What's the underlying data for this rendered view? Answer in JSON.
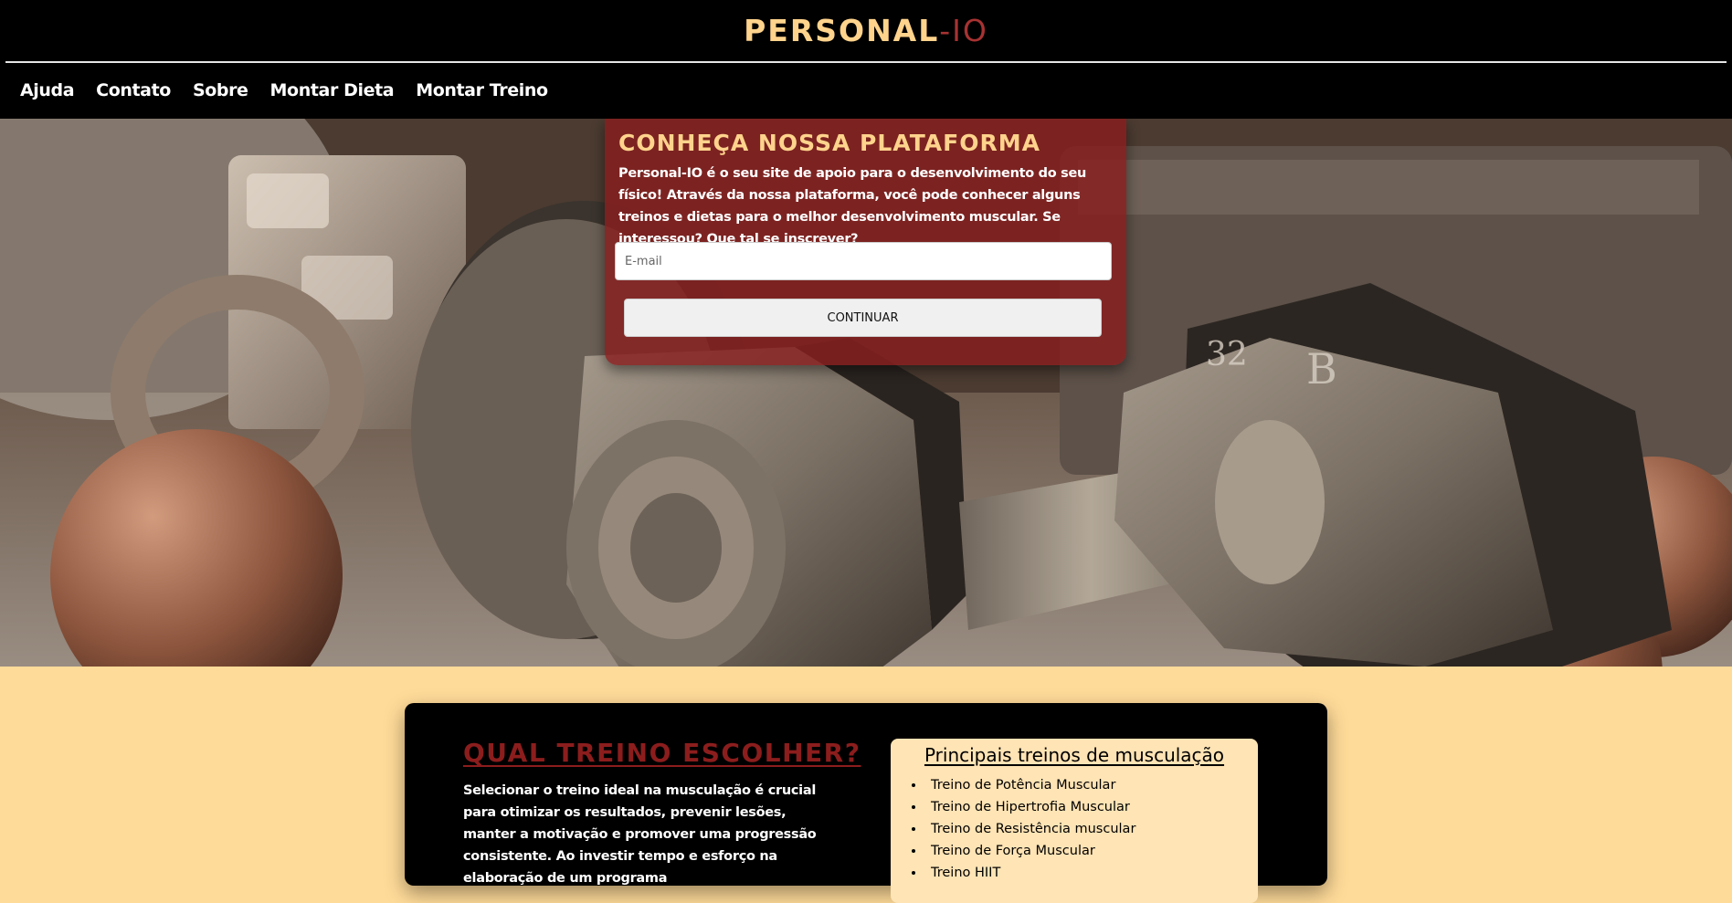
{
  "header": {
    "logo_primary": "PERSONAL",
    "logo_accent": "-IO",
    "nav": [
      "Ajuda",
      "Contato",
      "Sobre",
      "Montar Dieta",
      "Montar Treino"
    ]
  },
  "hero": {
    "title": "CONHEÇA NOSSA PLATAFORMA",
    "description": "Personal-IO é o seu site de apoio para o desenvolvimento do seu físico! Através da nossa plataforma, você pode conhecer alguns treinos e dietas para o melhor desenvolvimento muscular. Se interessou? Que tal se inscrever?",
    "email_placeholder": "E-mail",
    "continue_label": "CONTINUAR"
  },
  "section": {
    "title": "QUAL TREINO ESCOLHER?",
    "text": "Selecionar o treino ideal na musculação é crucial para otimizar os resultados, prevenir lesões, manter a motivação e promover uma progressão consistente. Ao investir tempo e esforço na elaboração de um programa",
    "list_title": "Principais treinos de musculação",
    "list_items": [
      "Treino de Potência Muscular",
      "Treino de Hipertrofia Muscular",
      "Treino de Resistência muscular",
      "Treino de Força Muscular",
      "Treino HIIT"
    ]
  },
  "colors": {
    "header_bg": "#000000",
    "logo_gold": "#ffd38c",
    "logo_red": "#a83232",
    "card_red": "#871e1e",
    "page_bg": "#ffdb99",
    "list_bg": "#ffe4b5"
  }
}
